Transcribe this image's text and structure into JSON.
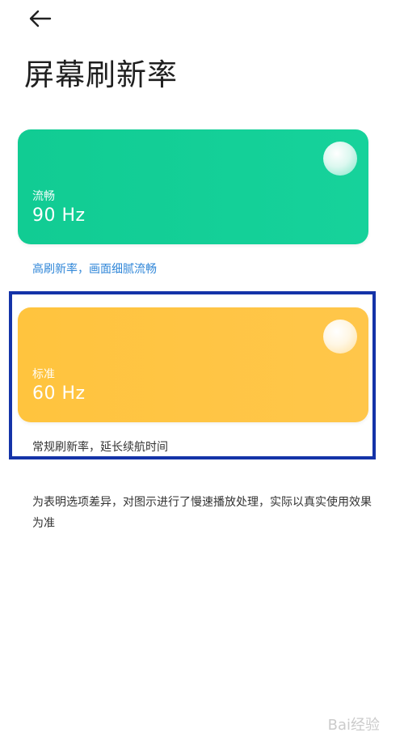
{
  "header": {
    "title": "屏幕刷新率"
  },
  "options": {
    "smooth": {
      "name": "流畅",
      "value": "90 Hz",
      "description": "高刷新率，画面细腻流畅",
      "color": "#14cf97"
    },
    "standard": {
      "name": "标准",
      "value": "60 Hz",
      "description": "常规刷新率，延长续航时间",
      "color": "#ffc443"
    }
  },
  "highlight": {
    "color": "#1433a8"
  },
  "footnote": "为表明选项差异，对图示进行了慢速播放处理，实际以真实使用效果为准",
  "watermark": {
    "text": "Bai经验"
  }
}
